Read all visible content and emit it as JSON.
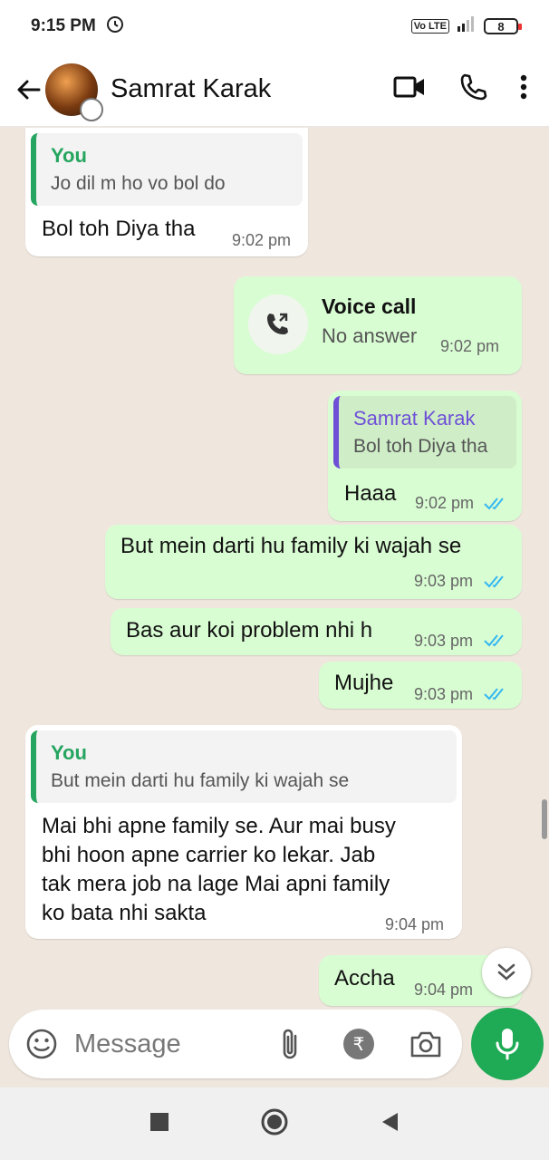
{
  "status_bar": {
    "time": "9:15 PM",
    "battery": "8"
  },
  "header": {
    "contact_name": "Samrat Karak"
  },
  "messages": [
    {
      "reply_name": "You",
      "reply_text": "Jo dil m ho vo bol do",
      "text": "Bol toh Diya tha",
      "time": "9:02 pm"
    },
    {
      "call_title": "Voice call",
      "call_status": "No answer",
      "time": "9:02 pm"
    },
    {
      "reply_name": "Samrat Karak",
      "reply_text": "Bol toh Diya tha",
      "text": "Haaa",
      "time": "9:02 pm"
    },
    {
      "text": "But mein darti hu family ki wajah se",
      "time": "9:03 pm"
    },
    {
      "text": "Bas aur koi problem nhi h",
      "time": "9:03 pm"
    },
    {
      "text": "Mujhe",
      "time": "9:03 pm"
    },
    {
      "reply_name": "You",
      "reply_text": "But mein darti hu family ki wajah se",
      "lines": [
        "Mai bhi apne family se. Aur mai busy",
        "bhi hoon apne carrier ko lekar.  Jab",
        "tak mera job na lage Mai apni family",
        "ko bata nhi sakta"
      ],
      "time": "9:04 pm"
    },
    {
      "text": "Accha",
      "time": "9:04 pm"
    }
  ],
  "composer": {
    "placeholder": "Message"
  },
  "colors": {
    "accent_green": "#1faa55",
    "outgoing_bubble": "#d9fdd3",
    "read_ticks": "#34b7f1",
    "reply_purple": "#6e4fd6"
  }
}
